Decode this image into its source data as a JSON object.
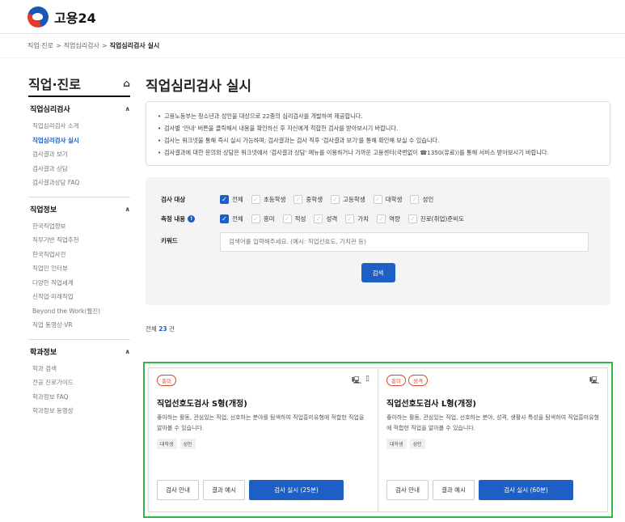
{
  "header": {
    "logo_text": "고용24"
  },
  "breadcrumb": {
    "items": [
      "직업·진로",
      "직업심리검사"
    ],
    "sep": ">",
    "current": "직업심리검사 실시"
  },
  "sidebar": {
    "title": "직업·진로",
    "groups": [
      {
        "title": "직업심리검사",
        "items": [
          "직업심리검사 소개",
          "직업심리검사 실시",
          "검사결과 보기",
          "검사결과 상담",
          "검사결과상담 FAQ"
        ]
      },
      {
        "title": "직업정보",
        "items": [
          "한국직업정보",
          "직무기반 직업추천",
          "한국직업사전",
          "직업인 인터뷰",
          "다양한 직업세계",
          "신직업·미래직업",
          "Beyond the Work(웹진)",
          "직업 동영상·VR"
        ]
      },
      {
        "title": "학과정보",
        "items": [
          "학과 검색",
          "전공 진로가이드",
          "학과정보 FAQ",
          "학과정보 동영상"
        ]
      }
    ]
  },
  "main": {
    "title": "직업심리검사 실시",
    "info": [
      "고용노동부는 청소년과 성인을 대상으로 22종의 심리검사를 개발하여 제공합니다.",
      "검사별 '안내' 버튼을 클릭해서 내용을 확인하신 후 자신에게 적합한 검사를 받아보시기 바랍니다.",
      "검사는 워크넷을 통해 즉시 실시 가능하며, 검사결과는 검사 직후 '검사결과 보기'를 통해 확인해 보실 수 있습니다.",
      "검사결과에 대한 문의와 상담은 워크넷에서 '검사결과 상담' 메뉴를 이용하거나 가까운 고용센터(국번없이 ☎1350(유료))를 통해 서비스 받아보시기 바랍니다."
    ],
    "filters": {
      "target_label": "검사 대상",
      "target_options": [
        "전체",
        "초등학생",
        "중학생",
        "고등학생",
        "대학생",
        "성인"
      ],
      "measure_label": "측정 내용",
      "measure_options": [
        "전체",
        "흥미",
        "적성",
        "성격",
        "가치",
        "역량",
        "진로(취업)준비도"
      ],
      "keyword_label": "키워드",
      "keyword_placeholder": "검색어를 입력해주세요. (예시: 직업선호도, 가치관 등)",
      "search_label": "검색"
    },
    "total": {
      "prefix": "전체 ",
      "count": "23",
      "suffix": " 건"
    },
    "cards": [
      {
        "tags": [
          "흥미"
        ],
        "title": "직업선호도검사 S형(개정)",
        "desc": "좋아하는 활동, 관심있는 직업, 선호하는 분야를 탐색하여 직업흥미유형에 적합한 직업을 알아볼 수 있습니다.",
        "chips": [
          "대학생",
          "성인"
        ],
        "guide": "검사 안내",
        "example": "결과 예시",
        "start": "검사 실시 (25분)",
        "devices": [
          "desktop-icon",
          "mobile-icon"
        ]
      },
      {
        "tags": [
          "흥미",
          "성격"
        ],
        "title": "직업선호도검사 L형(개정)",
        "desc": "좋아하는 활동, 관심있는 직업, 선호하는 분야, 성격, 생활사 특성을 탐색하여 직업흥미유형에 적합한 직업을 알아볼 수 있습니다.",
        "chips": [
          "대학생",
          "성인"
        ],
        "guide": "검사 안내",
        "example": "결과 예시",
        "start": "검사 실시 (60분)",
        "devices": [
          "desktop-icon"
        ]
      }
    ]
  },
  "colors": {
    "accent": "#1d5fc4",
    "highlight": "#2fb54a",
    "tag": "#d9452b"
  }
}
